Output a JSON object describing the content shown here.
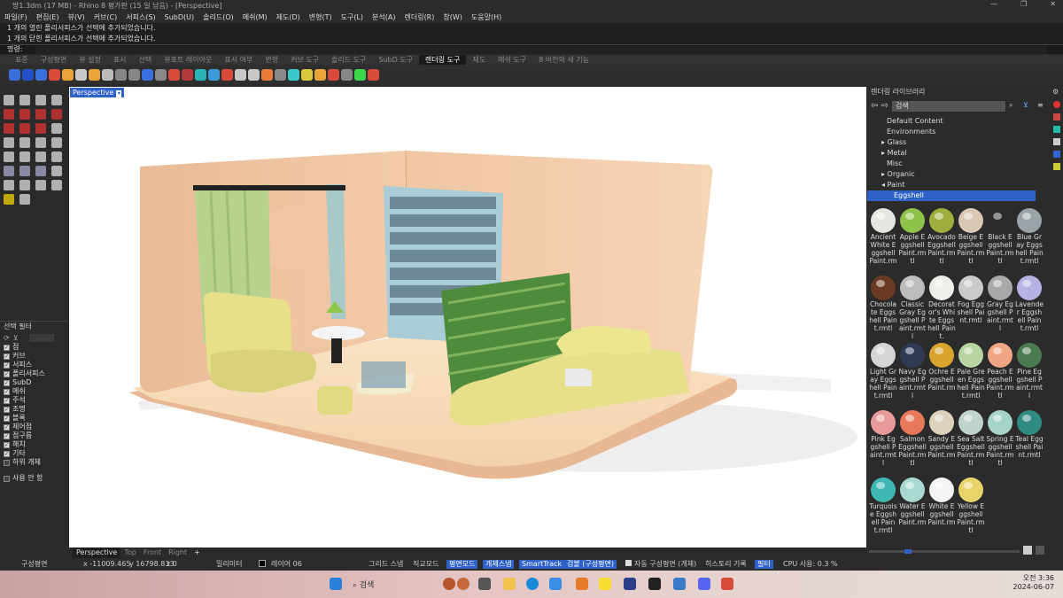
{
  "window": {
    "title": "방1.3dm (17 MB) - Rhino 8 평가판 (15 일 남음) - [Perspective]",
    "min": "—",
    "max": "❐",
    "close": "✕"
  },
  "menu": [
    "파일(F)",
    "편집(E)",
    "뷰(V)",
    "커브(C)",
    "서피스(S)",
    "SubD(U)",
    "솔리드(O)",
    "메쉬(M)",
    "제도(D)",
    "변형(T)",
    "도구(L)",
    "분석(A)",
    "렌더링(R)",
    "창(W)",
    "도움말(H)"
  ],
  "command_history": [
    "1 개의 열린 폴리서피스가 선택에 추가되었습니다.",
    "1 개의 닫힌 폴리서피스가 선택에 추가되었습니다."
  ],
  "command_prompt": "명령:",
  "toolbar_tabs": [
    "표준",
    "구성평면",
    "뷰 설정",
    "표시",
    "선택",
    "뷰포트 레이아웃",
    "표시 여부",
    "변형",
    "커브 도구",
    "솔리드 도구",
    "SubD 도구",
    "렌더링 도구",
    "제도",
    "메쉬 도구",
    "8 버전의 새 기능"
  ],
  "active_toolbar_tab": "렌더링 도구",
  "viewport": {
    "active_label": "Perspective",
    "tabs": [
      "Perspective",
      "Top",
      "Front",
      "Right"
    ],
    "add_tab": "+"
  },
  "selection_filter": {
    "title": "선택 필터",
    "items": [
      {
        "label": "점",
        "checked": true
      },
      {
        "label": "커브",
        "checked": true
      },
      {
        "label": "서피스",
        "checked": true
      },
      {
        "label": "폴리서피스",
        "checked": true
      },
      {
        "label": "SubD",
        "checked": true
      },
      {
        "label": "메쉬",
        "checked": true
      },
      {
        "label": "주석",
        "checked": true
      },
      {
        "label": "조명",
        "checked": true
      },
      {
        "label": "블록",
        "checked": true
      },
      {
        "label": "제어점",
        "checked": true
      },
      {
        "label": "점구름",
        "checked": true
      },
      {
        "label": "해치",
        "checked": true
      },
      {
        "label": "기타",
        "checked": true
      },
      {
        "label": "하위 개체",
        "checked": false
      }
    ],
    "disable": "사용 안 함"
  },
  "render_library": {
    "title": "렌더링 라이브러리",
    "search_placeholder": "검색",
    "tree": [
      {
        "label": "Default Content",
        "exp": false
      },
      {
        "label": "Environments",
        "exp": false
      },
      {
        "label": "▸ Glass",
        "exp": true
      },
      {
        "label": "▸ Metal",
        "exp": true
      },
      {
        "label": "Misc",
        "exp": false
      },
      {
        "label": "▸ Organic",
        "exp": true
      },
      {
        "label": "◂ Paint",
        "exp": true
      },
      {
        "label": "Eggshell",
        "sel": true
      }
    ],
    "materials": [
      {
        "name": "Ancient White Eggshell Paint.rm",
        "color": "#e8e6e0"
      },
      {
        "name": "Apple Eggshell Paint.rmtl",
        "color": "#8fc24a"
      },
      {
        "name": "Avocado Eggshell Paint.rmtl",
        "color": "#9fae3c"
      },
      {
        "name": "Beige Eggshell Paint.rmtl",
        "color": "#d8c8b4"
      },
      {
        "name": "Black Eggshell Paint.rmtl",
        "color": "#2a2a2a"
      },
      {
        "name": "Blue Gray Eggshell Paint.rmtl",
        "color": "#9aa3a8"
      },
      {
        "name": "Chocolate Eggshell Paint.rmtl",
        "color": "#6b3a24"
      },
      {
        "name": "Classic Gray Eggshell Paint.rmtl",
        "color": "#bcbcbc"
      },
      {
        "name": "Decorator's White Eggshell Paint.",
        "color": "#efefea"
      },
      {
        "name": "Fog Eggshell Paint.rmtl",
        "color": "#c9cbcb"
      },
      {
        "name": "Gray Eggshell Paint.rmtl",
        "color": "#a9a9a9"
      },
      {
        "name": "Lavender Eggshell Paint.rmtl",
        "color": "#b6b2e4"
      },
      {
        "name": "Light Gray Eggshell Paint.rmtl",
        "color": "#d5d5d5"
      },
      {
        "name": "Navy Eggshell Paint.rmtl",
        "color": "#2f3a55"
      },
      {
        "name": "Ochre Eggshell Paint.rm",
        "color": "#d9a52c"
      },
      {
        "name": "Pale Green Eggshell Paint.rmtl",
        "color": "#b8d4a0"
      },
      {
        "name": "Peach Eggshell Paint.rmtl",
        "color": "#f0a684"
      },
      {
        "name": "Pine Eggshell Paint.rmtl",
        "color": "#4c7a50"
      },
      {
        "name": "Pink Eggshell Paint.rmtl",
        "color": "#e89a9a"
      },
      {
        "name": "Salmon Eggshell Paint.rmtl",
        "color": "#e8785a"
      },
      {
        "name": "Sandy Eggshell Paint.rm",
        "color": "#ddd2bc"
      },
      {
        "name": "Sea Salt Eggshell Paint.rmtl",
        "color": "#bfd4cc"
      },
      {
        "name": "Spring Eggshell Paint.rmtl",
        "color": "#a6d4c8"
      },
      {
        "name": "Teal Eggshell Paint.rmtl",
        "color": "#2f8a80"
      },
      {
        "name": "Turquoise Eggshell Paint.rmtl",
        "color": "#3fb8b4"
      },
      {
        "name": "Water Eggshell Paint.rm",
        "color": "#a8d8d0"
      },
      {
        "name": "White Eggshell Paint.rm",
        "color": "#f4f4f2"
      },
      {
        "name": "Yellow Eggshell Paint.rmtl",
        "color": "#e8d46a"
      }
    ]
  },
  "status": {
    "cplane": "구성평면",
    "x": "x -11009.465",
    "y": "y 16798.833",
    "z": "z 0",
    "units": "밀리미터",
    "layer": "레이어 06",
    "grid_snap": "그리드 스냅",
    "ortho": "직교모드",
    "planar": "평면모드",
    "osnap": "개체스냅",
    "smarttrack": "SmartTrack",
    "gumball": "검볼 (구성평면)",
    "auto_cplane": "자동 구성평면 (개체)",
    "history": "히스토리 기록",
    "filter": "필터",
    "cpu": "CPU 사용: 0.3 %"
  },
  "taskbar": {
    "search": "검색",
    "time": "오전 3:36",
    "date": "2024-06-07"
  }
}
